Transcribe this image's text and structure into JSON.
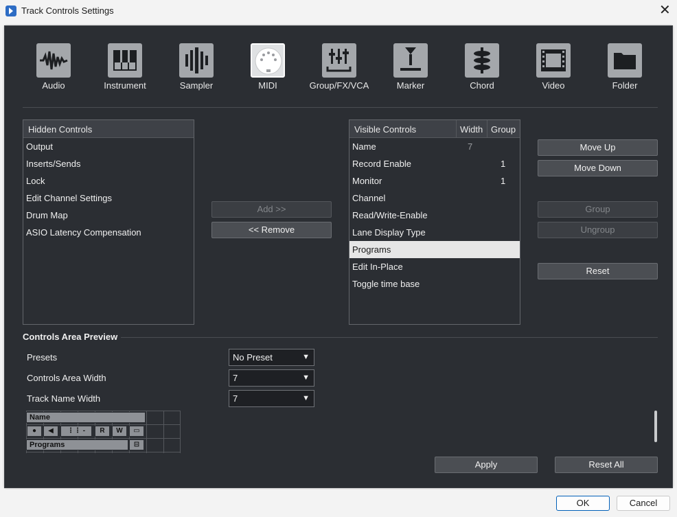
{
  "window": {
    "title": "Track Controls Settings"
  },
  "categories": [
    {
      "label": "Audio",
      "icon": "waveform-icon"
    },
    {
      "label": "Instrument",
      "icon": "piano-keys-icon"
    },
    {
      "label": "Sampler",
      "icon": "sampler-icon"
    },
    {
      "label": "MIDI",
      "icon": "midi-connector-icon",
      "active": true
    },
    {
      "label": "Group/FX/VCA",
      "icon": "faders-icon"
    },
    {
      "label": "Marker",
      "icon": "marker-icon"
    },
    {
      "label": "Chord",
      "icon": "chord-icon"
    },
    {
      "label": "Video",
      "icon": "film-icon"
    },
    {
      "label": "Folder",
      "icon": "folder-icon"
    }
  ],
  "hidden_controls": {
    "header": "Hidden Controls",
    "items": [
      "Output",
      "Inserts/Sends",
      "Lock",
      "Edit Channel Settings",
      "Drum Map",
      "ASIO Latency Compensation"
    ]
  },
  "visible_controls": {
    "headers": {
      "name": "Visible Controls",
      "width": "Width",
      "group": "Group"
    },
    "items": [
      {
        "name": "Name",
        "width": "7",
        "group": ""
      },
      {
        "name": "Record Enable",
        "width": "",
        "group": "1"
      },
      {
        "name": "Monitor",
        "width": "",
        "group": "1"
      },
      {
        "name": "Channel",
        "width": "",
        "group": ""
      },
      {
        "name": "Read/Write-Enable",
        "width": "",
        "group": ""
      },
      {
        "name": "Lane Display Type",
        "width": "",
        "group": ""
      },
      {
        "name": "Programs",
        "width": "",
        "group": "",
        "selected": true
      },
      {
        "name": "Edit In-Place",
        "width": "",
        "group": ""
      },
      {
        "name": "Toggle time base",
        "width": "",
        "group": ""
      }
    ]
  },
  "buttons": {
    "add": "Add >>",
    "remove": "<< Remove",
    "move_up": "Move Up",
    "move_down": "Move Down",
    "group": "Group",
    "ungroup": "Ungroup",
    "reset": "Reset",
    "apply": "Apply",
    "reset_all": "Reset All",
    "ok": "OK",
    "cancel": "Cancel"
  },
  "preview": {
    "section_title": "Controls Area Preview",
    "presets_label": "Presets",
    "presets_value": "No Preset",
    "controls_width_label": "Controls Area Width",
    "controls_width_value": "7",
    "track_name_width_label": "Track Name Width",
    "track_name_width_value": "7",
    "name_bar": "Name",
    "programs_bar": "Programs",
    "rec_btn": "R",
    "write_btn": "W"
  },
  "colors": {
    "background": "#2b2e33",
    "selected_row": "#e6e6e6",
    "active_tile": "#dfe1e3",
    "tile": "#a4a7ab"
  }
}
